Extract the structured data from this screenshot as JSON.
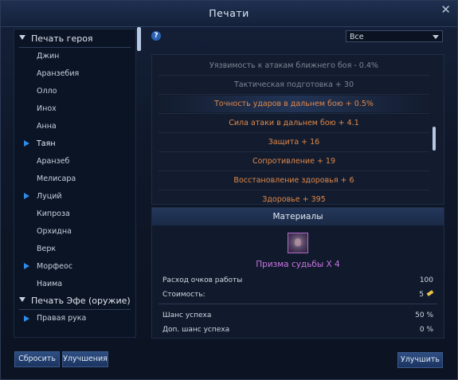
{
  "window": {
    "title": "Печати"
  },
  "tree": {
    "group1": "Печать героя",
    "items": [
      "Джин",
      "Аранзебия",
      "Олло",
      "Инох",
      "Анна",
      "Таян",
      "Аранзеб",
      "Мелисара",
      "Луций",
      "Кипроза",
      "Орхидна",
      "Верк",
      "Морфеос",
      "Наима"
    ],
    "group2": "Печать Эфе (оружие)",
    "subitems": [
      "Правая рука"
    ]
  },
  "filter": {
    "value": "Все"
  },
  "help": "?",
  "stats": [
    {
      "text": "Уязвимость к атакам ближнего боя - 0.4%",
      "color": "#7d8594"
    },
    {
      "text": "Тактическая подготовка + 30",
      "color": "#7d8594"
    },
    {
      "text": "Точность ударов в дальнем бою + 0.5%",
      "color": "#e0884a"
    },
    {
      "text": "Сила атаки в дальнем бою + 4.1",
      "color": "#e0884a"
    },
    {
      "text": "Защита + 16",
      "color": "#e0884a"
    },
    {
      "text": "Сопротивление + 19",
      "color": "#e0884a"
    },
    {
      "text": "Восстановление здоровья + 6",
      "color": "#e0884a"
    },
    {
      "text": "Здоровье + 395",
      "color": "#e0884a"
    }
  ],
  "materials": {
    "header": "Материалы",
    "item_name": "Призма судьбы X 4",
    "rows": [
      {
        "label": "Расход очков работы",
        "value": "100"
      },
      {
        "label": "Стоимость:",
        "value": "5"
      },
      {
        "label": "Шанс успеха",
        "value": "50 %"
      },
      {
        "label": "Доп. шанс успеха",
        "value": "0 %"
      }
    ]
  },
  "buttons": {
    "reset": "Сбросить",
    "improvements": "Улучшения",
    "improve": "Улучшить"
  },
  "colors": {
    "accent": "#2f8be8",
    "orange": "#e0884a",
    "gray": "#7d8594",
    "purple": "#c773e0"
  }
}
